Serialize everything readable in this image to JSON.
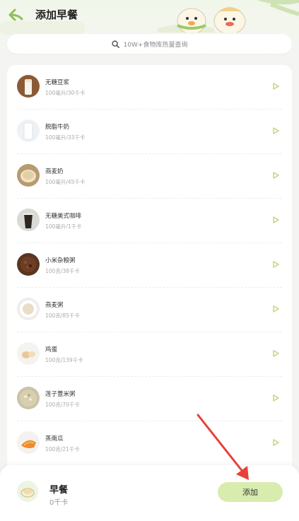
{
  "header": {
    "title": "添加早餐",
    "back_icon": "back-arrow-icon"
  },
  "search": {
    "placeholder": "10W+食物库热量查询",
    "icon": "search-icon"
  },
  "foods": [
    {
      "name": "无糖豆浆",
      "unit": "100毫升/30千卡",
      "thumb": "soymilk"
    },
    {
      "name": "脱脂牛奶",
      "unit": "100毫升/33千卡",
      "thumb": "milk"
    },
    {
      "name": "燕麦奶",
      "unit": "100毫升/45千卡",
      "thumb": "oatmilk"
    },
    {
      "name": "无糖美式咖啡",
      "unit": "100毫升/1千卡",
      "thumb": "coffee"
    },
    {
      "name": "小米杂粮粥",
      "unit": "100克/38千卡",
      "thumb": "grain-porridge"
    },
    {
      "name": "燕麦粥",
      "unit": "100克/85千卡",
      "thumb": "oat-porridge"
    },
    {
      "name": "鸡蛋",
      "unit": "100克/139千卡",
      "thumb": "egg"
    },
    {
      "name": "莲子薏米粥",
      "unit": "100克/70千卡",
      "thumb": "lotus-porridge"
    },
    {
      "name": "蒸南瓜",
      "unit": "100克/21千卡",
      "thumb": "pumpkin"
    }
  ],
  "bottom": {
    "meal_name": "早餐",
    "kcal": "0千卡",
    "add_label": "添加"
  },
  "colors": {
    "accent": "#d8ecae",
    "arrow": "#c5dc8a",
    "annotation": "#e8413a"
  }
}
